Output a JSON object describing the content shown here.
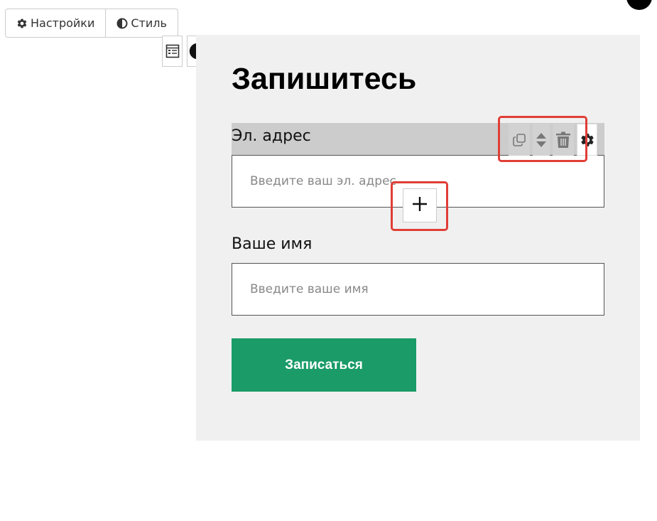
{
  "top_tabs": {
    "settings_label": "Настройки",
    "style_label": "Стиль"
  },
  "form": {
    "title": "Запишитесь",
    "email": {
      "label": "Эл. адрес",
      "placeholder": "Введите ваш эл. адрес"
    },
    "name": {
      "label": "Ваше имя",
      "placeholder": "Введите ваше имя"
    },
    "submit_label": "Записаться"
  },
  "field_toolbar": {
    "icons": [
      "copy-icon",
      "move-up-down-icon",
      "trash-icon",
      "gear-icon"
    ]
  },
  "add_button": {
    "symbol": "+"
  },
  "colors": {
    "submit": "#1a9b68",
    "highlight": "#e03e36",
    "panel_bg": "#f0f0f0",
    "selected_row": "#cccccc"
  }
}
